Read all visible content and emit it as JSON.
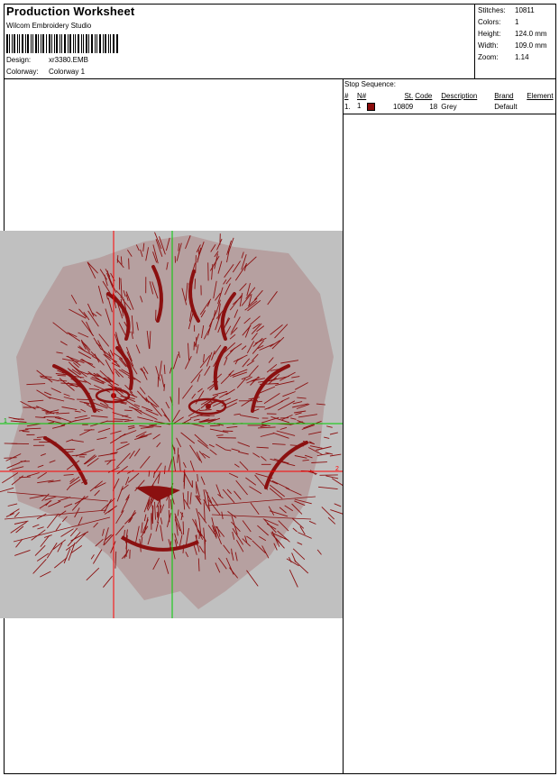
{
  "header": {
    "title": "Production Worksheet",
    "software": "Wilcom Embroidery Studio",
    "design_label": "Design:",
    "design_value": "xr3380.EMB",
    "colorway_label": "Colorway:",
    "colorway_value": "Colorway 1"
  },
  "stats": [
    {
      "label": "Stitches:",
      "value": "10811"
    },
    {
      "label": "Colors:",
      "value": "1"
    },
    {
      "label": "Height:",
      "value": "124.0 mm"
    },
    {
      "label": "Width:",
      "value": "109.0 mm"
    },
    {
      "label": "Zoom:",
      "value": "1.14"
    }
  ],
  "stop_sequence": {
    "caption": "Stop Sequence:",
    "columns": [
      "#",
      "N#",
      "St.",
      "Code",
      "Description",
      "Brand",
      "Element"
    ],
    "rows": [
      {
        "num": "1.",
        "needle": "1",
        "swatch_color": "#8b0c0c",
        "stitches": "10809",
        "code": "18",
        "description": "Grey",
        "brand": "Default",
        "element": ""
      }
    ]
  },
  "design": {
    "thread_color": "#8b1010",
    "background_color": "#c0c0c0",
    "marker_1": "1",
    "marker_2": "2"
  }
}
